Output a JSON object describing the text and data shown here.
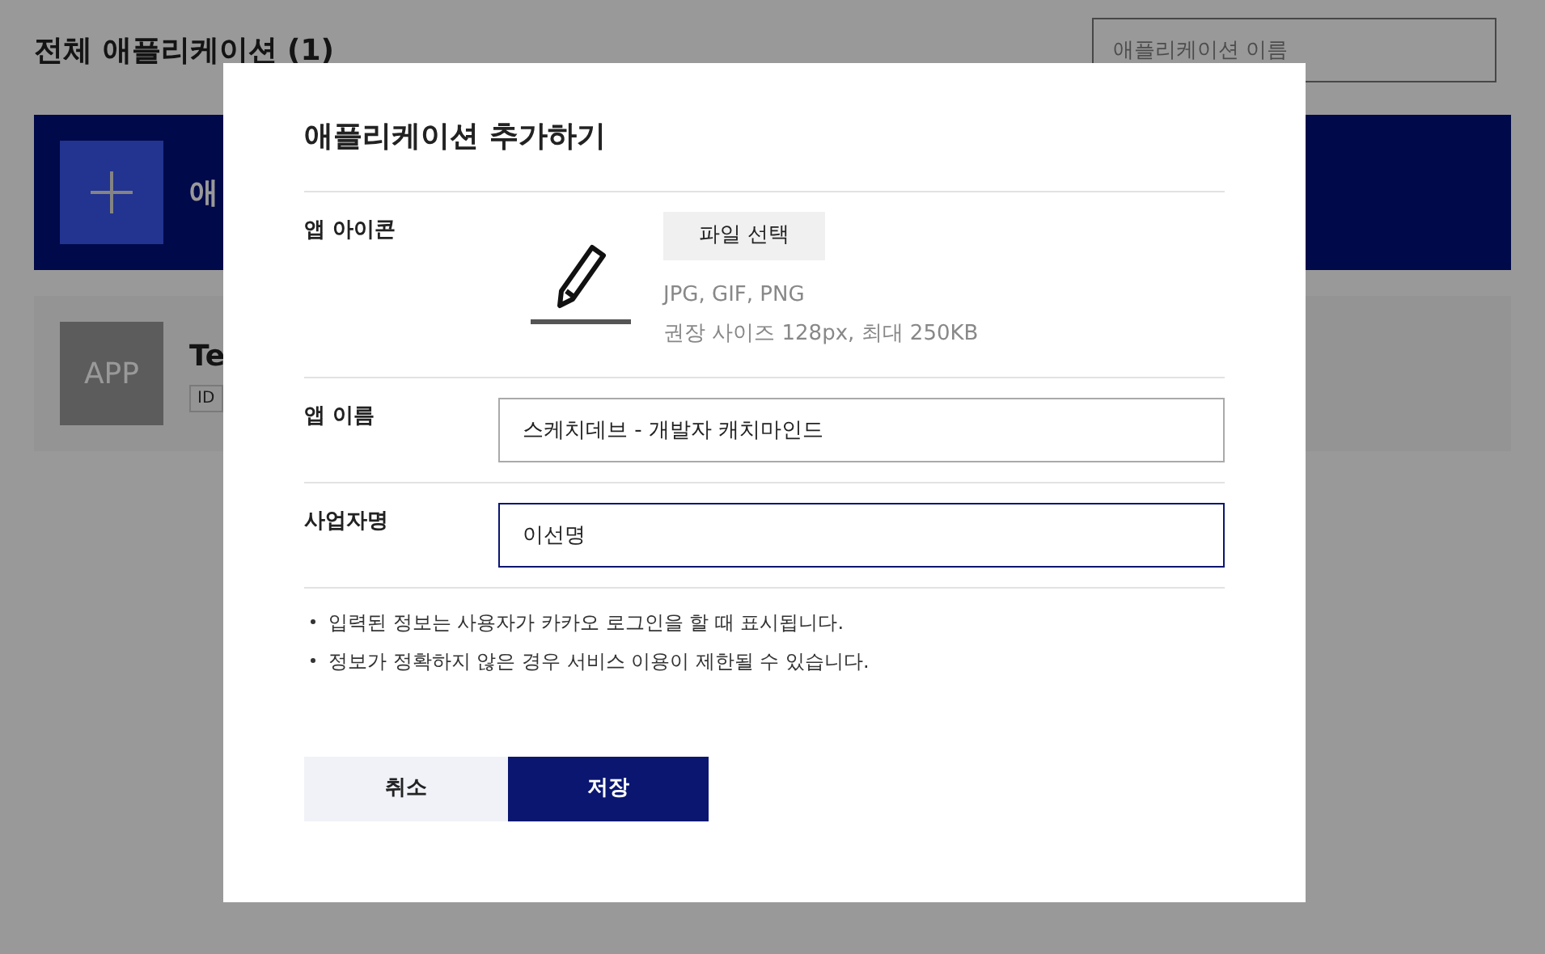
{
  "page": {
    "title": "전체 애플리케이션 (1)",
    "search": {
      "placeholder": "애플리케이션 이름"
    },
    "add_banner": {
      "label": "애"
    },
    "app_card": {
      "thumbnail": "APP",
      "name": "Te",
      "badge": "ID"
    }
  },
  "dialog": {
    "title": "애플리케이션 추가하기",
    "icon_row": {
      "label": "앱 아이콘",
      "file_button": "파일 선택",
      "formats": "JPG, GIF, PNG",
      "size_hint": "권장 사이즈 128px, 최대 250KB"
    },
    "fields": [
      {
        "label": "앱 이름",
        "value": "스케치데브 - 개발자 캐치마인드",
        "focused": false
      },
      {
        "label": "사업자명",
        "value": "이선명",
        "focused": true
      }
    ],
    "notes": [
      "입력된 정보는 사용자가 카카오 로그인을 할 때 표시됩니다.",
      "정보가 정확하지 않은 경우 서비스 이용이 제한될 수 있습니다."
    ],
    "buttons": [
      {
        "label": "취소",
        "kind": "secondary"
      },
      {
        "label": "저장",
        "kind": "primary"
      }
    ]
  }
}
